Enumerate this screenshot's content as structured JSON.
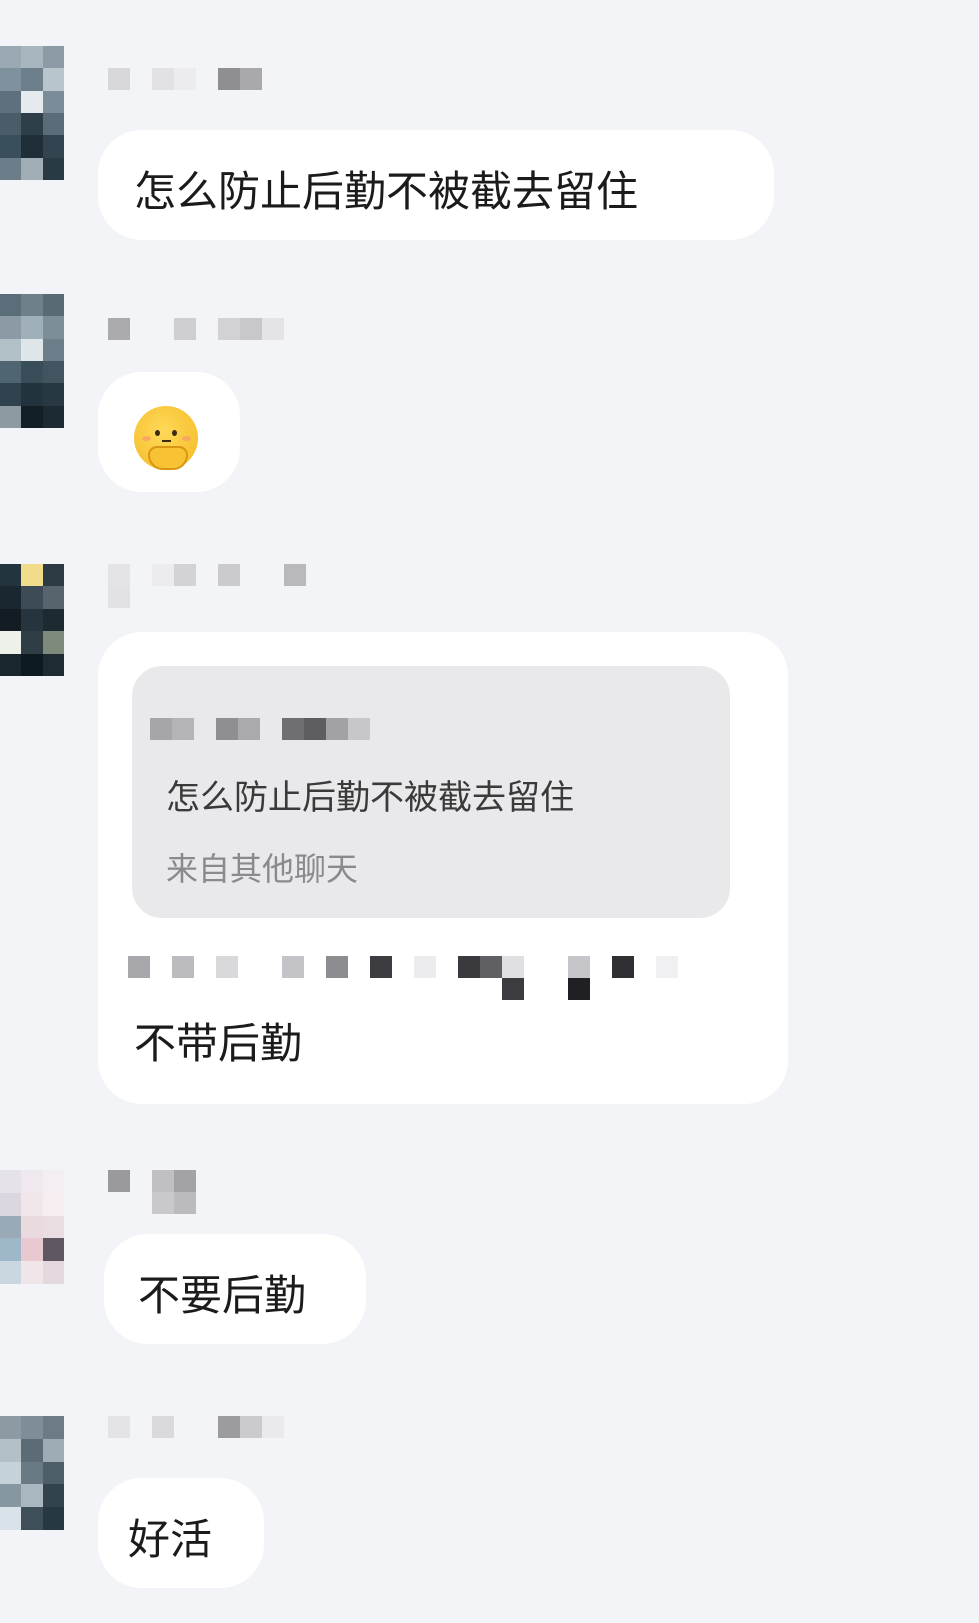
{
  "messages": [
    {
      "id": "m1",
      "type": "text",
      "text": "怎么防止后勤不被截去留住"
    },
    {
      "id": "m2",
      "type": "emoji",
      "icon": "thinking-hand-over-mouth-emoji"
    },
    {
      "id": "m3",
      "type": "quote-reply",
      "quote": {
        "text": "怎么防止后勤不被截去留住",
        "source": "来自其他聊天"
      },
      "text": "不带后勤"
    },
    {
      "id": "m4",
      "type": "text",
      "text": "不要后勤"
    },
    {
      "id": "m5",
      "type": "text",
      "text": "好活"
    }
  ],
  "colors": {
    "background": "#f3f4f8",
    "bubble": "#ffffff",
    "quote_card": "#e9e9ec",
    "text": "#1b1b1b",
    "muted_text": "#8a8a8e"
  }
}
